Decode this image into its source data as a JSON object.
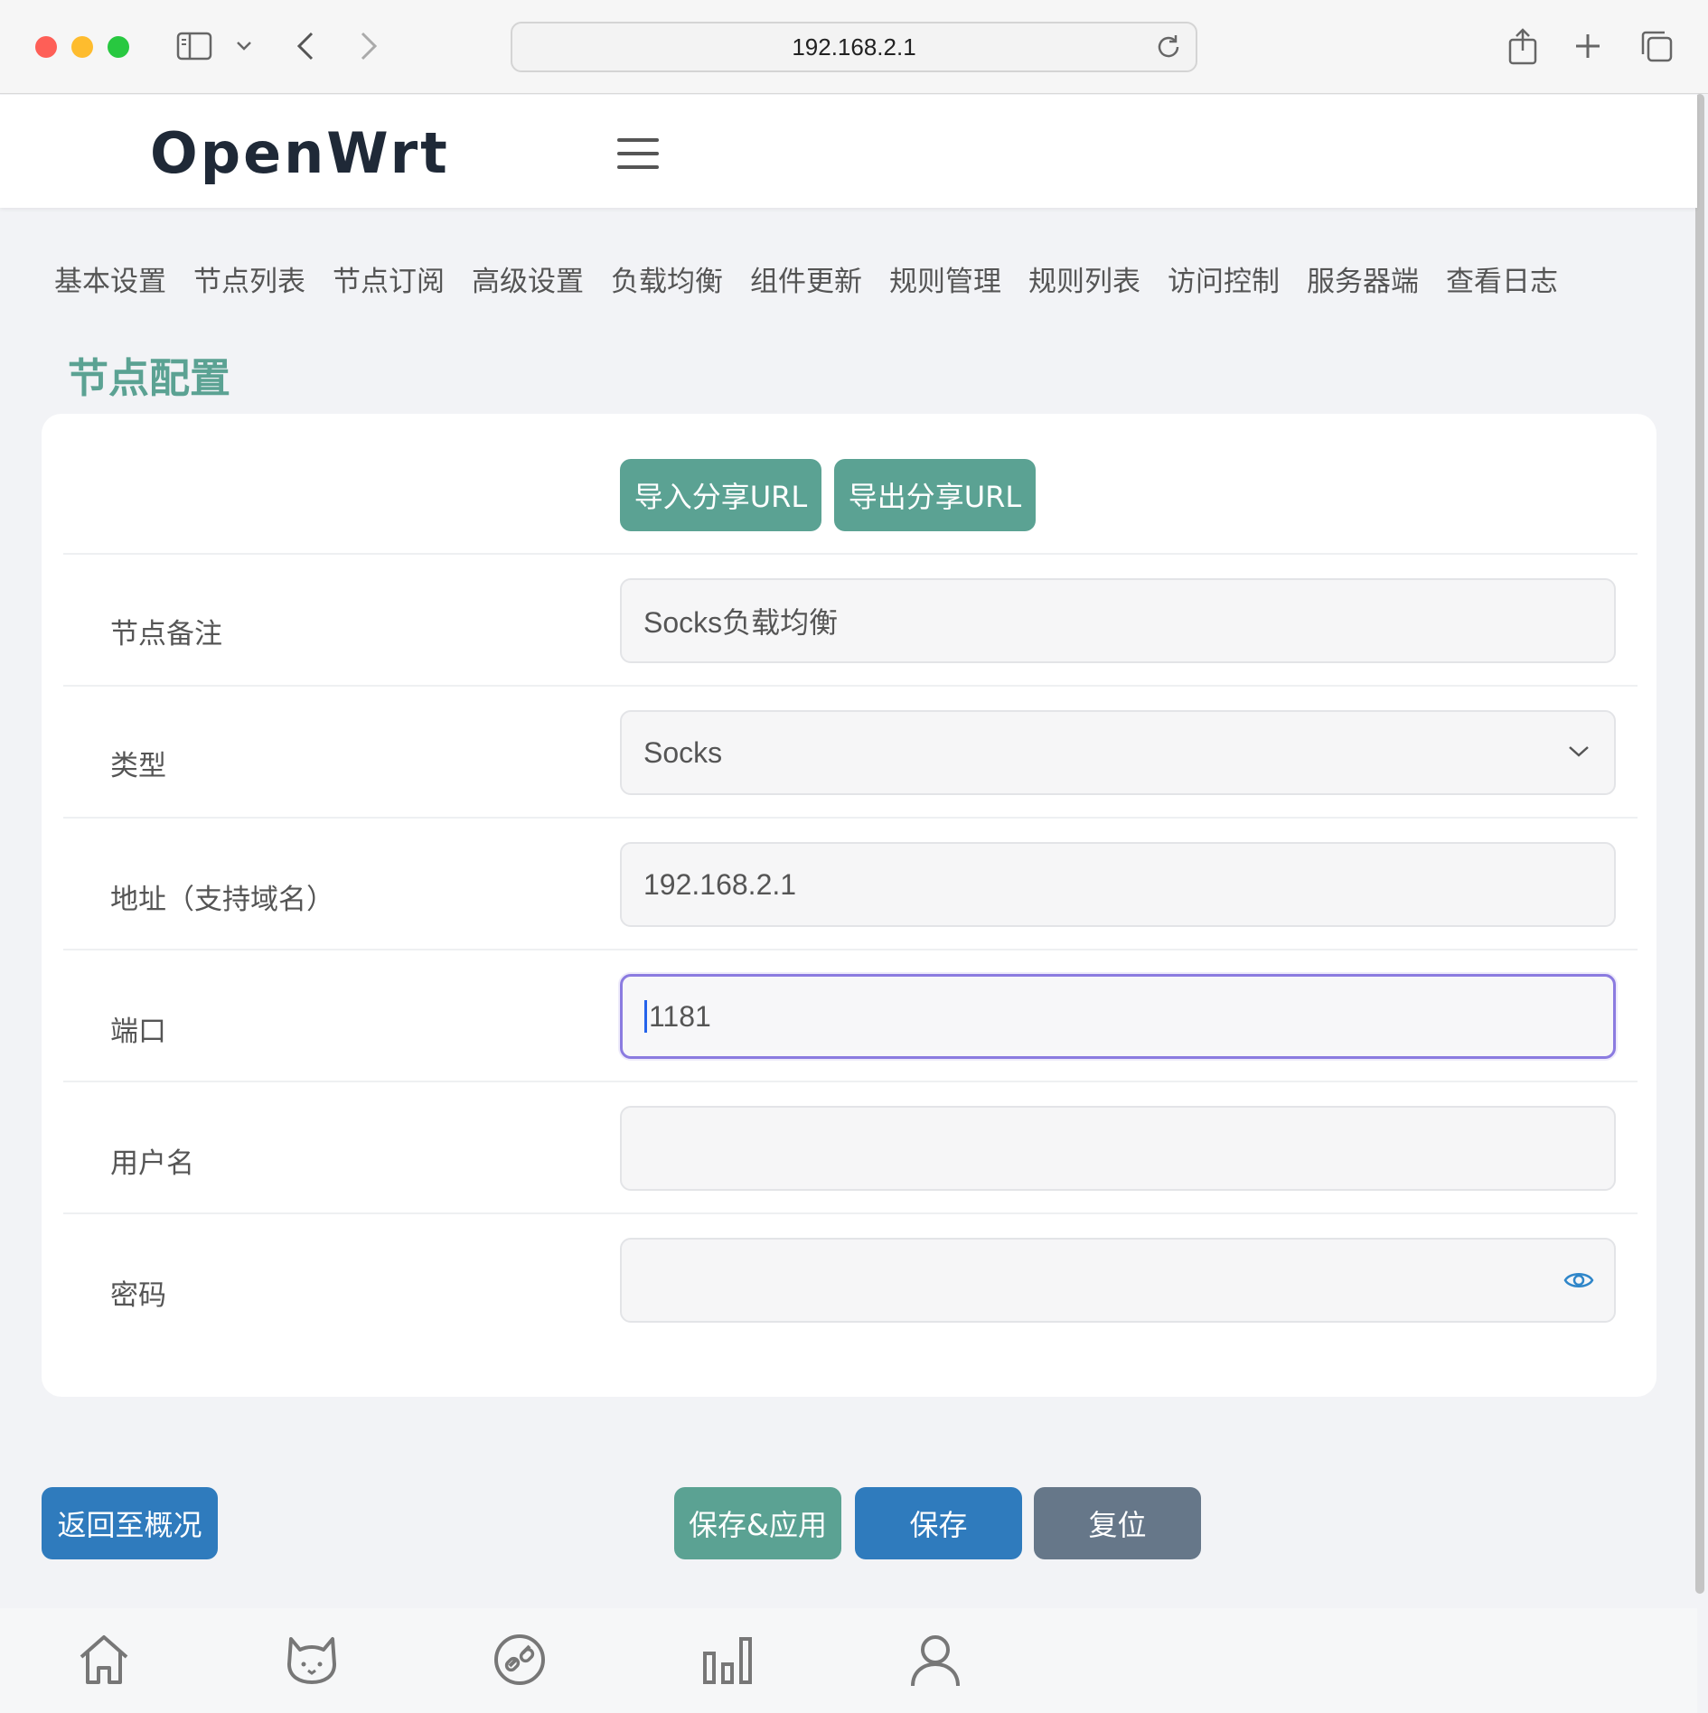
{
  "browser": {
    "url": "192.168.2.1"
  },
  "header": {
    "brand": "OpenWrt"
  },
  "tabs": [
    {
      "label": "基本设置"
    },
    {
      "label": "节点列表"
    },
    {
      "label": "节点订阅"
    },
    {
      "label": "高级设置"
    },
    {
      "label": "负载均衡"
    },
    {
      "label": "组件更新"
    },
    {
      "label": "规则管理"
    },
    {
      "label": "规则列表"
    },
    {
      "label": "访问控制"
    },
    {
      "label": "服务器端"
    },
    {
      "label": "查看日志"
    }
  ],
  "page": {
    "title": "节点配置",
    "import_label": "导入分享URL",
    "export_label": "导出分享URL"
  },
  "form": {
    "remark": {
      "label": "节点备注",
      "value": "Socks负载均衡"
    },
    "type": {
      "label": "类型",
      "value": "Socks"
    },
    "address": {
      "label": "地址（支持域名）",
      "value": "192.168.2.1"
    },
    "port": {
      "label": "端口",
      "value": "1181"
    },
    "username": {
      "label": "用户名",
      "value": ""
    },
    "password": {
      "label": "密码",
      "value": ""
    }
  },
  "actions": {
    "back": "返回至概况",
    "save_apply": "保存&应用",
    "save": "保存",
    "reset": "复位"
  },
  "colors": {
    "accent_teal": "#5ba293",
    "primary_blue": "#2f7bbd",
    "reset_grey": "#667789",
    "focus_purple": "#8b7be0"
  },
  "bottom_nav": [
    {
      "icon": "home-icon"
    },
    {
      "icon": "cat-icon"
    },
    {
      "icon": "link-icon"
    },
    {
      "icon": "bar-chart-icon"
    },
    {
      "icon": "user-icon"
    }
  ]
}
